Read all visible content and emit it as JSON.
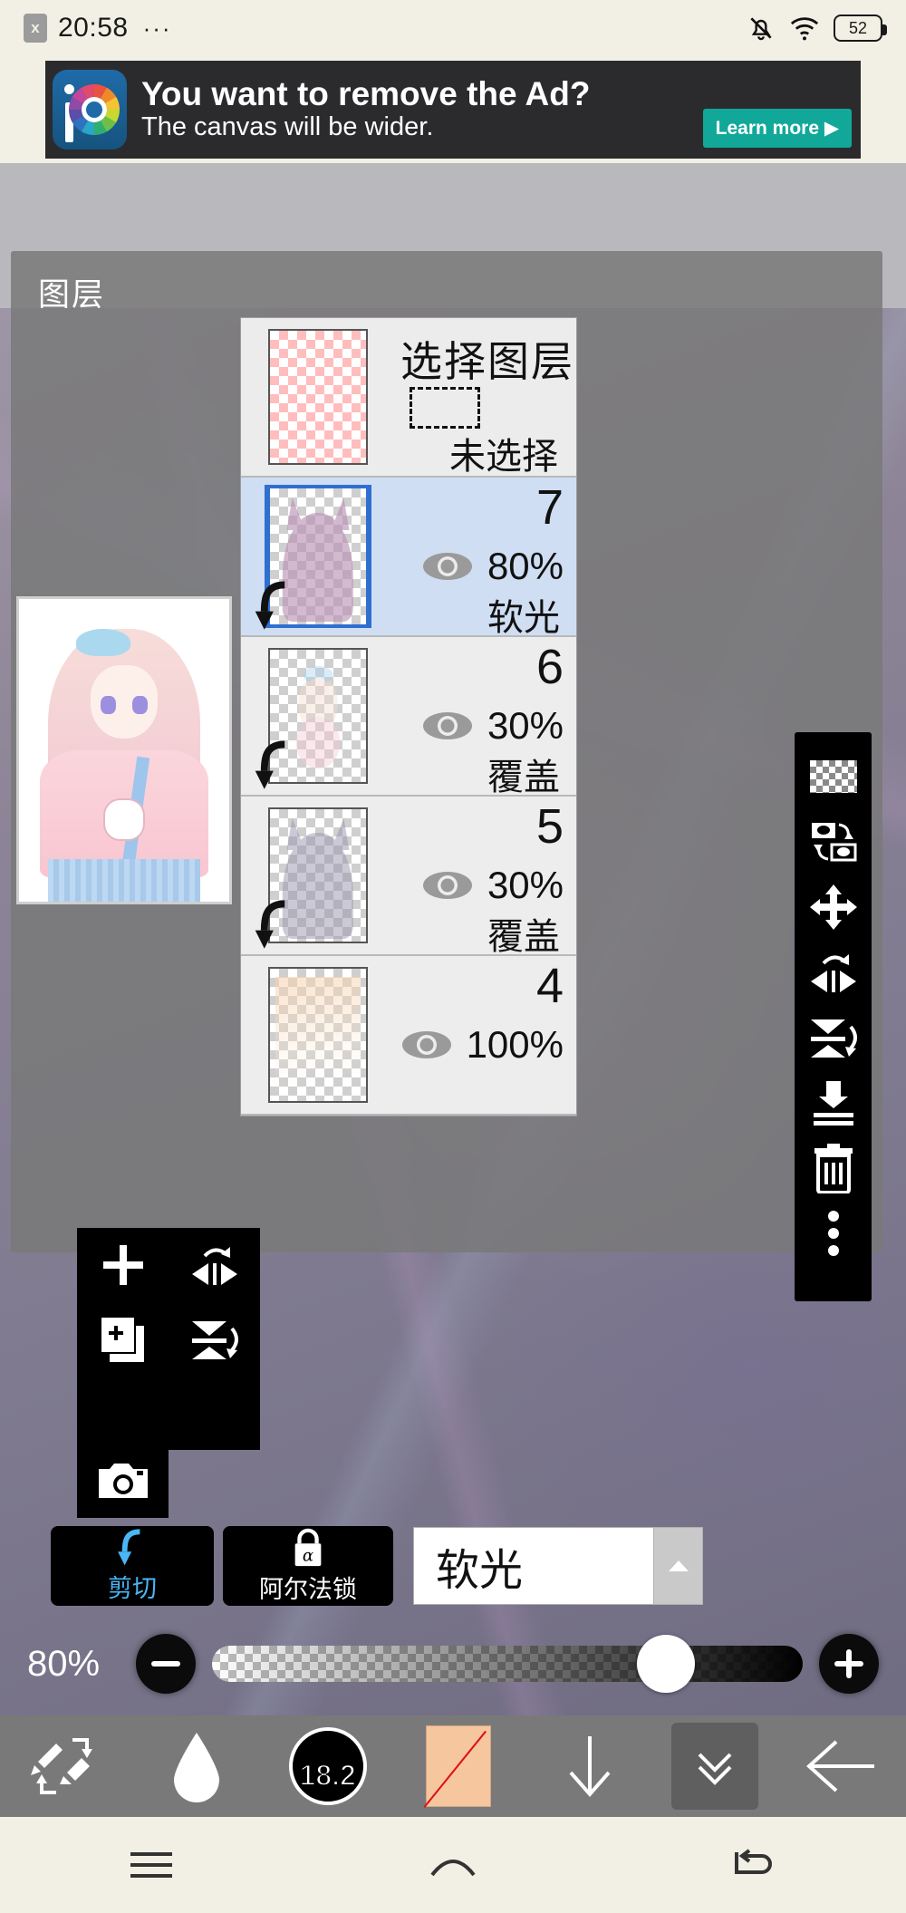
{
  "status_bar": {
    "close_badge": "x",
    "time": "20:58",
    "menu_dots": "···",
    "battery": "52",
    "icons": [
      "notification-muted-icon",
      "wifi-icon",
      "battery-icon"
    ]
  },
  "ad": {
    "line1": "You want to remove the Ad?",
    "line2": "The canvas will be wider.",
    "cta": "Learn more ▶",
    "brand": "ibisPaint",
    "bg_color": "#2b2b2d",
    "cta_color": "#11a89a"
  },
  "layer_panel": {
    "title": "图层",
    "header_row": {
      "title": "选择图层",
      "subtitle": "未选择",
      "thumb": "pink-checker-thumb"
    },
    "layers": [
      {
        "number": "7",
        "opacity": "80%",
        "blend": "软光",
        "selected": true,
        "clipped": true,
        "visible": true
      },
      {
        "number": "6",
        "opacity": "30%",
        "blend": "覆盖",
        "selected": false,
        "clipped": true,
        "visible": true
      },
      {
        "number": "5",
        "opacity": "30%",
        "blend": "覆盖",
        "selected": false,
        "clipped": true,
        "visible": true
      },
      {
        "number": "4",
        "opacity": "100%",
        "blend": "",
        "selected": false,
        "clipped": false,
        "visible": true
      }
    ]
  },
  "right_toolbar": {
    "items": [
      {
        "name": "transparency-checker-icon"
      },
      {
        "name": "swap-layers-icon"
      },
      {
        "name": "move-layer-icon"
      },
      {
        "name": "flip-horizontal-icon"
      },
      {
        "name": "flip-vertical-icon"
      },
      {
        "name": "merge-down-icon"
      },
      {
        "name": "delete-layer-icon"
      },
      {
        "name": "more-options-icon"
      }
    ]
  },
  "left_toolbar": {
    "items": [
      {
        "name": "add-layer-icon"
      },
      {
        "name": "flip-horizontal-icon"
      },
      {
        "name": "duplicate-layer-icon"
      },
      {
        "name": "flip-vertical-icon"
      },
      {
        "name": "camera-import-icon"
      }
    ]
  },
  "action_buttons": {
    "clipping": {
      "label": "剪切",
      "icon": "clipping-arrow-icon",
      "accent": "#4ab6f5"
    },
    "alpha_lock": {
      "label": "阿尔法锁",
      "icon": "alpha-lock-icon"
    },
    "blend_mode": {
      "value": "软光",
      "arrow": "▲"
    }
  },
  "opacity_slider": {
    "value": "80%",
    "minus": "−",
    "plus": "+",
    "knob_percent": 72
  },
  "bottom_toolbar": {
    "items": [
      {
        "name": "brush-eraser-toggle-icon",
        "label": ""
      },
      {
        "name": "droplet-icon",
        "label": ""
      },
      {
        "name": "brush-size-icon",
        "label": "18.2"
      },
      {
        "name": "color-swatch-icon",
        "label": "",
        "color": "#f6c69e"
      },
      {
        "name": "down-arrow-icon",
        "label": ""
      },
      {
        "name": "double-chevron-down-icon",
        "label": "",
        "active": true
      },
      {
        "name": "back-arrow-icon",
        "label": ""
      }
    ]
  },
  "nav_bar": {
    "items": [
      {
        "name": "recents-icon"
      },
      {
        "name": "home-icon"
      },
      {
        "name": "back-icon"
      }
    ]
  }
}
